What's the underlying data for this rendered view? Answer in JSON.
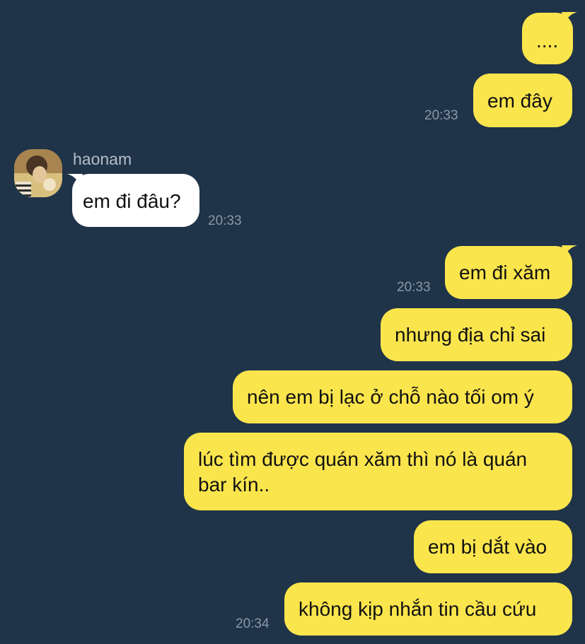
{
  "contact": {
    "name": "haonam"
  },
  "messages": [
    {
      "text": "....",
      "time": ""
    },
    {
      "text": "em đây",
      "time": "20:33"
    },
    {
      "text": "em đi đâu?",
      "time": "20:33"
    },
    {
      "text": "em đi xăm",
      "time": "20:33"
    },
    {
      "text": "nhưng địa chỉ sai",
      "time": ""
    },
    {
      "text": "nên em bị lạc ở chỗ nào tối om ý",
      "time": ""
    },
    {
      "text_line1": "lúc tìm được quán xăm thì nó là quán",
      "text_line2": "bar kín..",
      "time": ""
    },
    {
      "text": "em bị dắt vào",
      "time": ""
    },
    {
      "text": "không kịp nhắn tin cầu cứu",
      "time": "20:34"
    }
  ],
  "colors": {
    "background": "#1f3449",
    "outgoing_bubble": "#fbe54d",
    "incoming_bubble": "#ffffff",
    "timestamp": "#8b98a6"
  }
}
